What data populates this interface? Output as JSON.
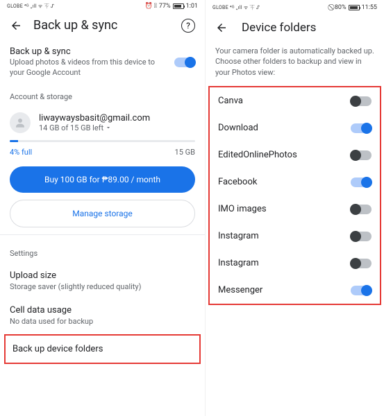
{
  "left": {
    "status": {
      "carrier": "GLOBE ⁴ᴳ ₊ıll ᯤ ⏇ ᔑ",
      "icons": "⏰ ⃠",
      "battery_pct": "77%",
      "time": "1:01"
    },
    "header": {
      "title": "Back up & sync"
    },
    "backup": {
      "title": "Back up & sync",
      "subtitle": "Upload photos & videos from this device to your Google Account",
      "toggle": true
    },
    "account_section_label": "Account & storage",
    "account": {
      "email": "liwaywaysbasit@gmail.com",
      "storage_text": "14 GB of 15 GB left"
    },
    "progress": {
      "pct_label": "4% full",
      "total_label": "15 GB"
    },
    "buy_button": "Buy 100 GB for ₱89.00 / month",
    "manage_button": "Manage storage",
    "settings_label": "Settings",
    "settings": [
      {
        "title": "Upload size",
        "sub": "Storage saver (slightly reduced quality)"
      },
      {
        "title": "Cell data usage",
        "sub": "No data used for backup"
      }
    ],
    "highlighted": {
      "title": "Back up device folders"
    }
  },
  "right": {
    "status": {
      "carrier": "GLOBE ⁴ᴳ ₊ıll ᯤ ⏇ ᔑ",
      "icons": "⃠",
      "battery_pct": "80%",
      "time": "11:55"
    },
    "header": {
      "title": "Device folders"
    },
    "intro": "Your camera folder is automatically backed up. Choose other folders to backup and view in your Photos view:",
    "folders": [
      {
        "name": "Canva",
        "on": false
      },
      {
        "name": "Download",
        "on": true
      },
      {
        "name": "EditedOnlinePhotos",
        "on": false
      },
      {
        "name": "Facebook",
        "on": true
      },
      {
        "name": "IMO images",
        "on": false
      },
      {
        "name": "Instagram",
        "on": false
      },
      {
        "name": "Instagram",
        "on": false
      },
      {
        "name": "Messenger",
        "on": true
      }
    ]
  }
}
